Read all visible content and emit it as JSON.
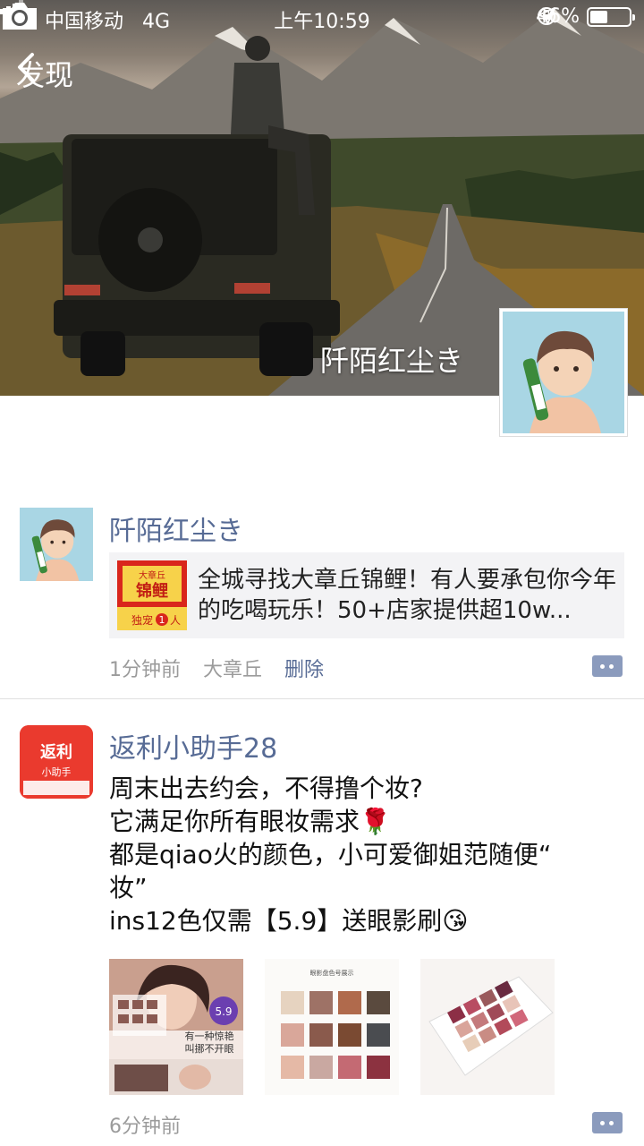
{
  "status_bar": {
    "carrier": "中国移动",
    "network": "4G",
    "time": "上午10:59",
    "battery_label": "46%",
    "battery_level": 0.46
  },
  "nav": {
    "back_label": "发现"
  },
  "profile": {
    "name": "阡陌红尘き"
  },
  "posts": [
    {
      "author": "阡陌红尘き",
      "shared_text": "全城寻找大章丘锦鲤！有人要承包你今年的吃喝玩乐！50+店家提供超10w...",
      "thumb_text": [
        "大章丘",
        "锦鲤",
        "独宠",
        "1",
        "人"
      ],
      "time": "1分钟前",
      "location": "大章丘",
      "delete_label": "删除"
    },
    {
      "author": "返利小助手28",
      "avatar_text": [
        "返利",
        "小助手"
      ],
      "lines": [
        "周末出去约会，不得撸个妆?",
        "它满足你所有眼妆需求🌹",
        "都是qiao火的颜色，小可爱御姐范随便“",
        "妆”",
        "ins12色仅需【5.9】送眼影刷😘"
      ],
      "photo1_text": [
        "5.9",
        "有一种惊艳",
        "叫挪不开眼"
      ],
      "photo2_title": "眼影盘色号展示",
      "time": "6分钟前"
    }
  ],
  "colors": {
    "link": "#576b95",
    "meta": "#9b9b9b",
    "shared_bg": "#f3f3f5"
  }
}
